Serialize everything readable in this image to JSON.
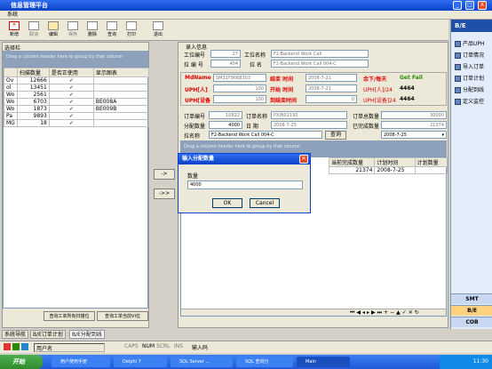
{
  "window": {
    "title": "信息管理平台",
    "controls": [
      "_",
      "□",
      "X"
    ]
  },
  "menu": {
    "system": "系统"
  },
  "toolbar": {
    "new": "新增",
    "cancel": "取消",
    "edit": "编辑",
    "save": "保存",
    "delete": "删除",
    "query": "查询",
    "print": "打印",
    "exit": "退出"
  },
  "left": {
    "title": "选择栏",
    "group_hint": "Drag a column header here to group by that column",
    "headers": [
      "扫描数量",
      "是否正使用",
      "显示图表"
    ],
    "rows": [
      {
        "c0": "Ov",
        "c1": "12666",
        "c3": ""
      },
      {
        "c0": "ol",
        "c1": "13451",
        "c3": ""
      },
      {
        "c0": "Wo",
        "c1": "2561",
        "c3": ""
      },
      {
        "c0": "Wo",
        "c1": "6703",
        "c3": "BE008A"
      },
      {
        "c0": "Wo",
        "c1": "1873",
        "c3": "BE009B"
      },
      {
        "c0": "Pa",
        "c1": "9893",
        "c3": ""
      },
      {
        "c0": "MG",
        "c1": "18",
        "c3": ""
      }
    ],
    "btn_query_all": "查询工单所有扫描位",
    "btn_query_current": "查询工单当前VI位"
  },
  "input_info": {
    "title": "录入信息",
    "work_no_label": "工位编号",
    "work_no": "27",
    "work_name_label": "工位名称",
    "work_name": "F2-Backend Work Call",
    "line_no_label": "拉 编 号",
    "line_no": "404",
    "line_name_label": "拉  名",
    "line_name": "F2-Backend Work Call 004-C"
  },
  "status": {
    "mdname_label": "MdName",
    "mdname": "SM31F9068303",
    "end_time_label": "结束 时间",
    "end_time": "2008-7-21",
    "remain_label": "余下/每天",
    "remain": "Get Fail",
    "uph_label": "UPH[人]",
    "uph": "100",
    "start_time_label": "开始 时间",
    "start_time": "2008-7-21",
    "uph_person_label": "UPH[人]/24",
    "uph_person": "4464",
    "uph_dev_label": "UPH[设备",
    "uph_dev": "100",
    "reach_time_label": "到结束时间",
    "reach_time": "0",
    "uph_dev24_label": "UPH[设备]24",
    "uph_dev24": "4464"
  },
  "order": {
    "order_no_label": "订单编号",
    "order_no": "10822",
    "order_name_label": "订单名称",
    "order_name": "PX/B02193",
    "order_total_label": "订单总数量",
    "order_total": "30000",
    "alloc_label": "分配数量",
    "alloc": "4000",
    "date_label": "日  期",
    "date": "2008-7-25",
    "done_label": "已完成数量",
    "done": "21374",
    "line_label": "拉名称",
    "line": "F2-Backend Work Call 004-C",
    "query_btn": "查询",
    "date2": "2008-7-25"
  },
  "grid": {
    "group_hint": "Drag a column header here to group by that column",
    "headers": [
      "当前完成数量",
      "计划时间",
      "计划数量"
    ],
    "row": {
      "done": "21374",
      "plan_time": "2008-7-25",
      "plan_qty": ""
    }
  },
  "arrows": {
    "right": "->",
    "all_right": "->>"
  },
  "dialog": {
    "title": "输入分配数量",
    "label": "数量",
    "value": "4000",
    "ok": "OK",
    "cancel": "Cancel"
  },
  "right_panel": {
    "header": "B/E",
    "items": [
      "产品UPH",
      "订单情况",
      "导入订单",
      "订单计划",
      "分配到线",
      "定义监控"
    ],
    "tabs": [
      "SMT",
      "B/E",
      "COB"
    ]
  },
  "bottom_tabs": [
    "系统导航",
    "B/E订单计划",
    "B/E分配到线"
  ],
  "statusbar": {
    "user": "用户名",
    "caps": "CAPS",
    "num": "NUM",
    "scrl": "SCRL",
    "ins": "INS",
    "input": "输入码"
  },
  "taskbar": {
    "start": "开始",
    "tasks": [
      "用户使用手册",
      "Delphi 7",
      "SQL Server ...",
      "SQL 查询分",
      "Main"
    ],
    "time": "11:30"
  }
}
